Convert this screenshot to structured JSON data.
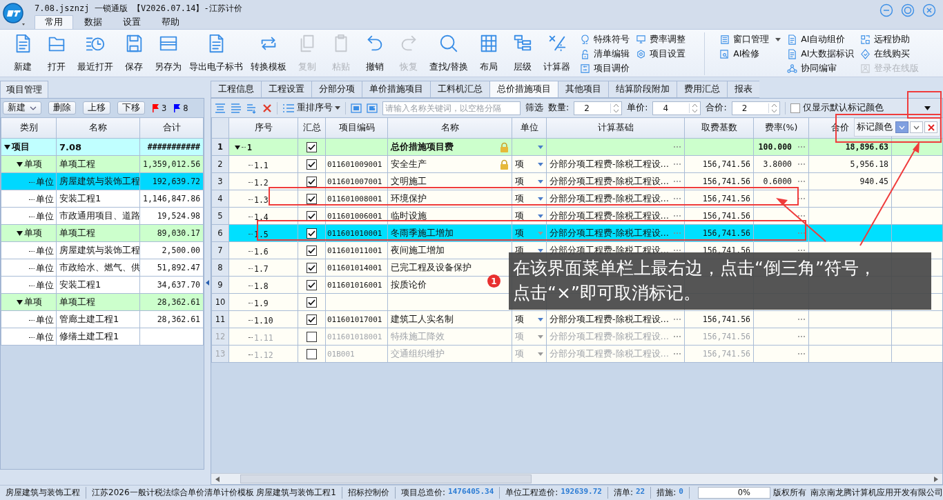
{
  "window": {
    "title": "7.08.jsznzj 一锁通版 【V2026.07.14】-江苏计价"
  },
  "menu_tabs": [
    {
      "label": "常用",
      "selected": true
    },
    {
      "label": "数据",
      "selected": false
    },
    {
      "label": "设置",
      "selected": false
    },
    {
      "label": "帮助",
      "selected": false
    }
  ],
  "ribbon": {
    "large_buttons": [
      {
        "label": "新建",
        "disabled": false
      },
      {
        "label": "打开",
        "disabled": false
      },
      {
        "label": "最近打开",
        "disabled": false
      },
      {
        "label": "保存",
        "disabled": false
      },
      {
        "label": "另存为",
        "disabled": false
      },
      {
        "label": "导出电子标书",
        "disabled": false
      },
      {
        "label": "转换模板",
        "disabled": false
      },
      {
        "label": "复制",
        "disabled": true
      },
      {
        "label": "粘贴",
        "disabled": true
      },
      {
        "label": "撤销",
        "disabled": false
      },
      {
        "label": "恢复",
        "disabled": true
      },
      {
        "label": "查找/替换",
        "disabled": false
      },
      {
        "label": "布局",
        "disabled": false
      },
      {
        "label": "层级",
        "disabled": false
      },
      {
        "label": "计算器",
        "disabled": false
      }
    ],
    "small_groups": [
      [
        {
          "label": "特殊符号",
          "disabled": false,
          "dropdown": false
        },
        {
          "label": "清单编辑",
          "disabled": false,
          "dropdown": false
        },
        {
          "label": "项目调价",
          "disabled": false,
          "dropdown": false
        }
      ],
      [
        {
          "label": "费率调整",
          "disabled": false,
          "dropdown": false
        },
        {
          "label": "项目设置",
          "disabled": false,
          "dropdown": false
        }
      ],
      [
        {
          "label": "窗口管理",
          "disabled": false,
          "dropdown": true
        },
        {
          "label": "AI检修",
          "disabled": false,
          "dropdown": false
        }
      ],
      [
        {
          "label": "AI自动组价",
          "disabled": false,
          "dropdown": false
        },
        {
          "label": "AI大数据标识",
          "disabled": false,
          "dropdown": false
        },
        {
          "label": "协同编审",
          "disabled": false,
          "dropdown": false
        }
      ],
      [
        {
          "label": "远程协助",
          "disabled": false,
          "dropdown": false
        },
        {
          "label": "在线购买",
          "disabled": false,
          "dropdown": false
        },
        {
          "label": "登录在线版",
          "disabled": true,
          "dropdown": false
        }
      ]
    ]
  },
  "left_panel": {
    "tab": "项目管理",
    "buttons": [
      {
        "label": "新建",
        "dropdown": true
      },
      {
        "label": "删除",
        "dropdown": false
      },
      {
        "label": "上移",
        "dropdown": false
      },
      {
        "label": "下移",
        "dropdown": false
      }
    ],
    "flags": [
      {
        "color": "#ff0000",
        "count": "3"
      },
      {
        "color": "#0000ff",
        "count": "8"
      }
    ],
    "columns": [
      "类别",
      "名称",
      "合计"
    ],
    "tree": [
      {
        "kind": "project",
        "type": "项目",
        "name": "7.08",
        "total": "###########",
        "selected": false,
        "children": [
          {
            "kind": "single",
            "type": "单项",
            "name": "单项工程",
            "total": "1,359,012.56",
            "selected": false,
            "children": [
              {
                "kind": "unit",
                "type": "单位",
                "name": "房屋建筑与装饰工程",
                "total": "192,639.72",
                "selected": true
              },
              {
                "kind": "unit",
                "type": "单位",
                "name": "安装工程1",
                "total": "1,146,847.86",
                "selected": false
              },
              {
                "kind": "unit",
                "type": "单位",
                "name": "市政通用项目、道路",
                "total": "19,524.98",
                "selected": false
              }
            ]
          },
          {
            "kind": "single",
            "type": "单项",
            "name": "单项工程",
            "total": "89,030.17",
            "selected": false,
            "children": [
              {
                "kind": "unit",
                "type": "单位",
                "name": "房屋建筑与装饰工程",
                "total": "2,500.00",
                "selected": false
              },
              {
                "kind": "unit",
                "type": "单位",
                "name": "市政给水、燃气、供",
                "total": "51,892.47",
                "selected": false
              },
              {
                "kind": "unit",
                "type": "单位",
                "name": "安装工程1",
                "total": "34,637.70",
                "selected": false
              }
            ]
          },
          {
            "kind": "single",
            "type": "单项",
            "name": "单项工程",
            "total": "28,362.61",
            "selected": false,
            "children": [
              {
                "kind": "unit",
                "type": "单位",
                "name": "管廊土建工程1",
                "total": "28,362.61",
                "selected": false
              },
              {
                "kind": "unit",
                "type": "单位",
                "name": "修缮土建工程1",
                "selected": false
              }
            ]
          }
        ]
      }
    ]
  },
  "tabs": [
    {
      "label": "工程信息",
      "selected": false
    },
    {
      "label": "工程设置",
      "selected": false
    },
    {
      "label": "分部分项",
      "selected": false
    },
    {
      "label": "单价措施项目",
      "selected": false
    },
    {
      "label": "工料机汇总",
      "selected": false
    },
    {
      "label": "总价措施项目",
      "selected": true
    },
    {
      "label": "其他项目",
      "selected": false
    },
    {
      "label": "结算阶段附加",
      "selected": false
    },
    {
      "label": "费用汇总",
      "selected": false
    },
    {
      "label": "报表",
      "selected": false
    }
  ],
  "toolbar": {
    "sort_button": "重排序号",
    "search": {
      "placeholder": "请输入名称关键词，以空格分隔"
    },
    "filter_label": "筛选",
    "spinners": [
      {
        "label": "数量:",
        "value": "2"
      },
      {
        "label": "单价:",
        "value": "4"
      },
      {
        "label": "合价:",
        "value": "2"
      }
    ],
    "checkbox": {
      "label": "仅显示默认标记颜色",
      "checked": false
    }
  },
  "mark_color_popup": {
    "label": "标记颜色",
    "color": "#7f9fe0"
  },
  "table": {
    "columns": [
      "序号",
      "汇总",
      "项目编码",
      "名称",
      "单位",
      "计算基础",
      "取费基数",
      "费率(%)",
      "合价"
    ],
    "rows": [
      {
        "no": "1",
        "kind": "group",
        "seq": "1",
        "checked": true,
        "code": "",
        "name": "总价措施项目费",
        "locked": true,
        "unit": "",
        "basis": "",
        "base": "",
        "rate": "100.000",
        "total": "18,896.63",
        "selected": false,
        "disabled": false
      },
      {
        "no": "2",
        "kind": "item",
        "seq": "1.1",
        "checked": true,
        "code": "011601009001",
        "name": "安全生产",
        "locked": true,
        "unit": "项",
        "basis": "分部分项工程费-除税工程设…",
        "base": "156,741.56",
        "rate": "3.8000",
        "total": "5,956.18",
        "selected": false,
        "disabled": false
      },
      {
        "no": "3",
        "kind": "item",
        "seq": "1.2",
        "checked": true,
        "code": "011601007001",
        "name": "文明施工",
        "locked": false,
        "unit": "项",
        "basis": "分部分项工程费-除税工程设…",
        "base": "156,741.56",
        "rate": "0.6000",
        "total": "940.45",
        "selected": false,
        "disabled": false
      },
      {
        "no": "4",
        "kind": "item",
        "seq": "1.3",
        "checked": true,
        "code": "011601008001",
        "name": "环境保护",
        "locked": false,
        "unit": "项",
        "basis": "分部分项工程费-除税工程设…",
        "base": "156,741.56",
        "selected": false,
        "disabled": false
      },
      {
        "no": "5",
        "kind": "item",
        "seq": "1.4",
        "checked": true,
        "code": "011601006001",
        "name": "临时设施",
        "locked": false,
        "unit": "项",
        "basis": "分部分项工程费-除税工程设…",
        "base": "156,741.56",
        "selected": false,
        "disabled": false
      },
      {
        "no": "6",
        "kind": "item",
        "seq": "1.5",
        "checked": true,
        "code": "011601010001",
        "name": "冬雨季施工增加",
        "locked": false,
        "unit": "项",
        "basis": "分部分项工程费-除税工程设…",
        "base": "156,741.56",
        "selected": true,
        "disabled": false
      },
      {
        "no": "7",
        "kind": "item",
        "seq": "1.6",
        "checked": true,
        "code": "011601011001",
        "name": "夜间施工增加",
        "locked": false,
        "unit": "项",
        "basis": "分部分项工程费-除税工程设…",
        "base": "156,741.56",
        "selected": false,
        "disabled": false
      },
      {
        "no": "8",
        "kind": "item",
        "seq": "1.7",
        "checked": true,
        "code": "011601014001",
        "name": "已完工程及设备保护",
        "locked": false,
        "selected": false,
        "disabled": false
      },
      {
        "no": "9",
        "kind": "item",
        "seq": "1.8",
        "checked": true,
        "code": "011601016001",
        "name": "按质论价",
        "locked": false,
        "selected": false,
        "disabled": false
      },
      {
        "no": "10",
        "kind": "item",
        "seq": "1.9",
        "checked": true,
        "code": "",
        "name": "",
        "locked": false,
        "selected": false,
        "disabled": false
      },
      {
        "no": "11",
        "kind": "item",
        "seq": "1.10",
        "checked": true,
        "code": "011601017001",
        "name": "建筑工人实名制",
        "locked": false,
        "unit": "项",
        "basis": "分部分项工程费-除税工程设…",
        "base": "156,741.56",
        "selected": false,
        "disabled": false
      },
      {
        "no": "12",
        "kind": "item",
        "seq": "1.11",
        "checked": false,
        "code": "011601018001",
        "name": "特殊施工降效",
        "locked": false,
        "unit": "项",
        "basis": "分部分项工程费-除税工程设…",
        "base": "156,741.56",
        "selected": false,
        "disabled": true
      },
      {
        "no": "13",
        "kind": "item",
        "seq": "1.12",
        "checked": false,
        "code": "01B001",
        "name": "交通组织维护",
        "locked": false,
        "unit": "项",
        "basis": "分部分项工程费-除税工程设…",
        "base": "156,741.56",
        "selected": false,
        "disabled": true
      }
    ]
  },
  "callout": {
    "number": "1",
    "text": "在该界面菜单栏上最右边，点击“倒三角”符号，点击“×”即可取消标记。"
  },
  "status_bar": {
    "items": [
      {
        "label": "房屋建筑与装饰工程"
      },
      {
        "label": "江苏2026一般计税法综合单价清单计价模板 房屋建筑与装饰工程1"
      },
      {
        "label": "招标控制价"
      },
      {
        "label": "项目总造价:",
        "value": "1476405.34"
      },
      {
        "label": "单位工程造价:",
        "value": "192639.72"
      },
      {
        "label": "清单:",
        "value": "22"
      },
      {
        "label": "措施:",
        "value": "0"
      }
    ],
    "progress": {
      "level": 0,
      "reading": "0%"
    },
    "copyright": "版权所有",
    "company": "南京南龙腾计算机应用开发有限公司"
  }
}
